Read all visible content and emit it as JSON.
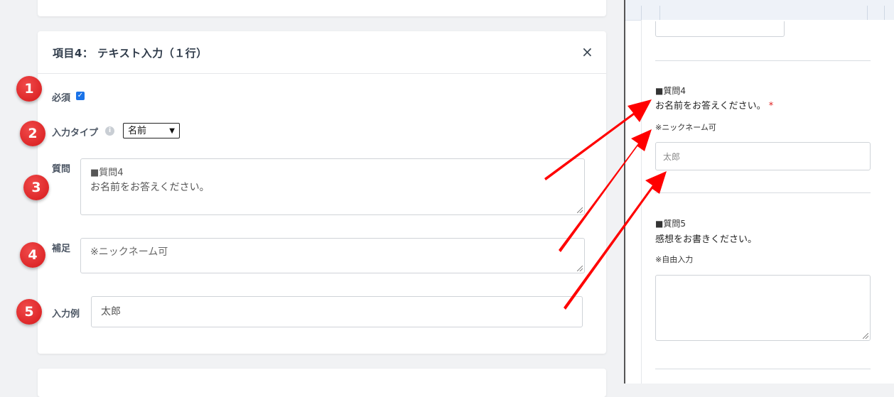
{
  "form": {
    "title": "項目4： テキスト入力（１行）",
    "close_icon": "×",
    "required_label": "必須",
    "required_checked": true,
    "input_type_label": "入力タイプ",
    "input_type_value": "名前",
    "question_label": "質問",
    "question_line1": "■質問4",
    "question_line2": "お名前をお答えください。",
    "note_label": "補足",
    "note_value": "※ニックネーム可",
    "example_label": "入力例",
    "example_value": "太郎"
  },
  "badges": [
    "1",
    "2",
    "3",
    "4",
    "5"
  ],
  "preview": {
    "q4_heading": "■質問4",
    "q4_text": "お名前をお答えください。",
    "q4_required_mark": "*",
    "q4_note": "※ニックネーム可",
    "q4_placeholder": "太郎",
    "q5_heading": "■質問5",
    "q5_text": "感想をお書きください。",
    "q5_note": "※自由入力"
  },
  "colors": {
    "badge": "#d6191b",
    "arrow": "#ff0000",
    "checkbox": "#1a73e8"
  },
  "icons": {
    "close": "close-icon",
    "info": "info-icon",
    "checkbox": "checkbox-icon"
  }
}
